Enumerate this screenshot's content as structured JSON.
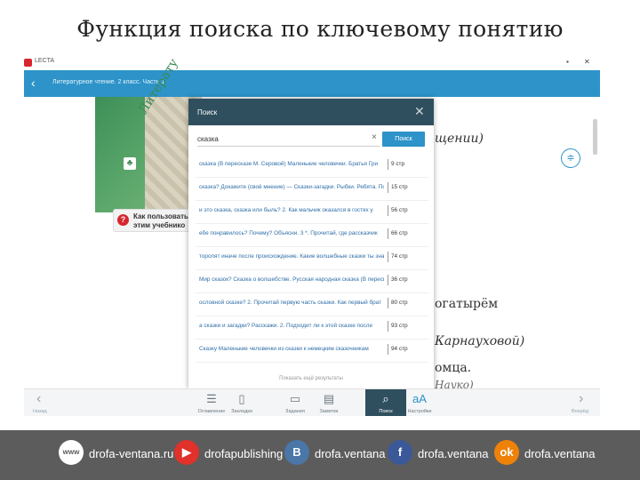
{
  "slide": {
    "title": "Функция поиска по ключевому понятию"
  },
  "os_bar": {
    "app_name": "LECTA",
    "minimize": "▪",
    "close": "✕"
  },
  "app_bar": {
    "back": "‹",
    "book_title": "Литературное чтение. 2 класс. Часть 1"
  },
  "cover": {
    "title_fragment": "Литерату"
  },
  "help": {
    "line1": "Как пользовать",
    "line2": "этим учебнико"
  },
  "background_text": {
    "line1": "щении)",
    "line2": "огатырём",
    "line3": "Карнауховой)",
    "line4": "омца.",
    "line5": "Науко)"
  },
  "dialog": {
    "title": "Поиск",
    "close": "✕",
    "search_value": "сказка",
    "search_placeholder": "",
    "search_button": "Поиск",
    "results": [
      {
        "text": "сказка (В пересказе М. Серовой) Маленькие человечки. Братья Гри",
        "page": "9 стр"
      },
      {
        "text": "сказка? Докажите (своё мнение) — Сказки-загадки. Рыбки. Ребята. После",
        "page": "15 стр"
      },
      {
        "text": "и это сказка, сказка или быль? 2. Как мальчик оказался в гостях у",
        "page": "56 стр"
      },
      {
        "text": "ебе понравилось? Почему? Объясни. 3 *. Прочитай, где рассказчик",
        "page": "66 стр"
      },
      {
        "text": "торопят иначе после происхождение. Какие волшебные сказки ты знаешь",
        "page": "74 стр"
      },
      {
        "text": "Мир сказок? Сказка о волшебстве. Русская народная сказка (В пересказе",
        "page": "36 стр"
      },
      {
        "text": "ословной сказке? 2. Прочитай первую часть сказки. Как первый брат",
        "page": "80 стр"
      },
      {
        "text": "а сказки и загадки? Расскажи. 2. Подходит ли к этой сказке после",
        "page": "93 стр"
      },
      {
        "text": "Сказку Маленькие человечки из сказки к немецким сказочникам",
        "page": "94 стр"
      }
    ],
    "footer": "Показать ещё результаты"
  },
  "toolbar": {
    "prev_label": "Назад",
    "next_label": "Вперёд",
    "items": [
      {
        "icon": "☰",
        "label": "Оглавление"
      },
      {
        "icon": "▯",
        "label": "Закладки"
      },
      {
        "icon": "▭",
        "label": "Задания"
      },
      {
        "icon": "▤",
        "label": "Заметки"
      },
      {
        "icon": "⌕",
        "label": "Поиск"
      },
      {
        "icon": "aA",
        "label": "Настройки"
      }
    ]
  },
  "social": [
    {
      "icon": "www",
      "label": "drofa-ventana.ru",
      "color": "#ffffff"
    },
    {
      "icon": "▶",
      "label": "drofapublishing",
      "color": "#e0312a"
    },
    {
      "icon": "B",
      "label": "drofa.ventana",
      "color": "#4a76a8"
    },
    {
      "icon": "f",
      "label": "drofa.ventana",
      "color": "#3b5998"
    },
    {
      "icon": "ok",
      "label": "drofa.ventana",
      "color": "#ee8208"
    }
  ]
}
